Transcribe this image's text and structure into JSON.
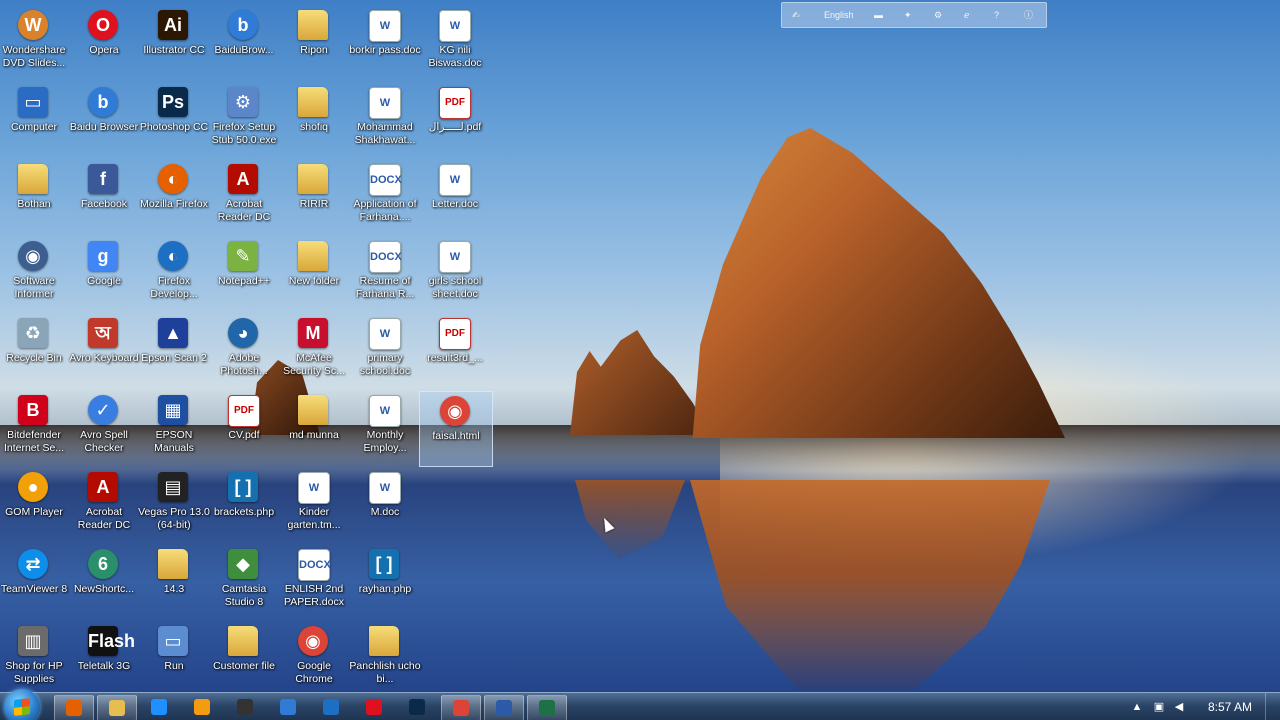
{
  "language_bar": {
    "language": "English"
  },
  "desktop_icons": [
    {
      "label": "Wondershare DVD Slides...",
      "glyph": "W",
      "color": "#d9822b",
      "kind": "round"
    },
    {
      "label": "Opera",
      "glyph": "O",
      "color": "#e0111f",
      "kind": "round"
    },
    {
      "label": "Illustrator CC",
      "glyph": "Ai",
      "color": "#2b1702",
      "kind": "app"
    },
    {
      "label": "BaiduBrow...",
      "glyph": "b",
      "color": "#2f7bd6",
      "kind": "round"
    },
    {
      "label": "Ripon",
      "glyph": "",
      "color": "#e6bd50",
      "kind": "folder"
    },
    {
      "label": "borkir pass.doc",
      "glyph": "W",
      "color": "#2b5aa8",
      "kind": "doc"
    },
    {
      "label": "KG nili Biswas.doc",
      "glyph": "W",
      "color": "#2b5aa8",
      "kind": "doc"
    },
    {
      "label": "Computer",
      "glyph": "▭",
      "color": "#2a6bc4",
      "kind": "app"
    },
    {
      "label": "Baidu Browser",
      "glyph": "b",
      "color": "#2f7bd6",
      "kind": "round"
    },
    {
      "label": "Photoshop CC",
      "glyph": "Ps",
      "color": "#0a2a4a",
      "kind": "app"
    },
    {
      "label": "Firefox Setup Stub 50.0.exe",
      "glyph": "⚙",
      "color": "#5b86c9",
      "kind": "app"
    },
    {
      "label": "shofiq",
      "glyph": "",
      "color": "#e6bd50",
      "kind": "folder"
    },
    {
      "label": "Mohammad Shakhawat...",
      "glyph": "W",
      "color": "#2b5aa8",
      "kind": "doc"
    },
    {
      "label": "لـــــرال.pdf",
      "glyph": "PDF",
      "color": "#c00000",
      "kind": "pdf"
    },
    {
      "label": "Bothan",
      "glyph": "",
      "color": "#e6bd50",
      "kind": "folder"
    },
    {
      "label": "Facebook",
      "glyph": "f",
      "color": "#3b5998",
      "kind": "app"
    },
    {
      "label": "Mozilla Firefox",
      "glyph": "◐",
      "color": "#e66000",
      "kind": "round"
    },
    {
      "label": "Acrobat Reader DC",
      "glyph": "A",
      "color": "#b30b00",
      "kind": "app"
    },
    {
      "label": "RIRIR",
      "glyph": "",
      "color": "#e6bd50",
      "kind": "folder"
    },
    {
      "label": "Application of Farhana....",
      "glyph": "DOCX",
      "color": "#2b5aa8",
      "kind": "doc"
    },
    {
      "label": "Letter.doc",
      "glyph": "W",
      "color": "#2b5aa8",
      "kind": "doc"
    },
    {
      "label": "Software Informer",
      "glyph": "◉",
      "color": "#3d5f8f",
      "kind": "round"
    },
    {
      "label": "Google",
      "glyph": "g",
      "color": "#4285f4",
      "kind": "app"
    },
    {
      "label": "Firefox Develop...",
      "glyph": "◐",
      "color": "#1c6fc2",
      "kind": "round"
    },
    {
      "label": "Notepad++",
      "glyph": "✎",
      "color": "#7bb241",
      "kind": "app"
    },
    {
      "label": "New folder",
      "glyph": "",
      "color": "#e6bd50",
      "kind": "folder"
    },
    {
      "label": "Resume of Farhana R...",
      "glyph": "DOCX",
      "color": "#2b5aa8",
      "kind": "doc"
    },
    {
      "label": "girls school sheet.doc",
      "glyph": "W",
      "color": "#2b5aa8",
      "kind": "doc"
    },
    {
      "label": "Recycle Bin",
      "glyph": "♻",
      "color": "#8aa4b8",
      "kind": "app"
    },
    {
      "label": "Avro Keyboard",
      "glyph": "অ",
      "color": "#c0392b",
      "kind": "app"
    },
    {
      "label": "Epson Scan 2",
      "glyph": "▲",
      "color": "#1e3f9a",
      "kind": "app"
    },
    {
      "label": "Adobe Photosh...",
      "glyph": "◕",
      "color": "#2266aa",
      "kind": "round"
    },
    {
      "label": "McAfee Security Sc...",
      "glyph": "M",
      "color": "#c8102e",
      "kind": "app"
    },
    {
      "label": "primary school.doc",
      "glyph": "W",
      "color": "#2b5aa8",
      "kind": "doc"
    },
    {
      "label": "result3rd_...",
      "glyph": "PDF",
      "color": "#c00000",
      "kind": "pdf"
    },
    {
      "label": "Bitdefender Internet Se...",
      "glyph": "B",
      "color": "#d0021b",
      "kind": "app"
    },
    {
      "label": "Avro Spell Checker",
      "glyph": "✓",
      "color": "#3a7de0",
      "kind": "round"
    },
    {
      "label": "EPSON Manuals",
      "glyph": "▦",
      "color": "#1e4fa0",
      "kind": "app"
    },
    {
      "label": "CV.pdf",
      "glyph": "PDF",
      "color": "#c00000",
      "kind": "pdf"
    },
    {
      "label": "md munna",
      "glyph": "",
      "color": "#e6bd50",
      "kind": "folder"
    },
    {
      "label": "Monthly Employ...",
      "glyph": "W",
      "color": "#2b5aa8",
      "kind": "doc"
    },
    {
      "label": "faisal.html",
      "glyph": "◉",
      "color": "#db4437",
      "kind": "round"
    },
    {
      "label": "GOM Player",
      "glyph": "●",
      "color": "#f2a007",
      "kind": "round"
    },
    {
      "label": "Acrobat Reader DC",
      "glyph": "A",
      "color": "#b30b00",
      "kind": "app"
    },
    {
      "label": "Vegas Pro 13.0 (64-bit)",
      "glyph": "▤",
      "color": "#222222",
      "kind": "app"
    },
    {
      "label": "brackets.php",
      "glyph": "[ ]",
      "color": "#1470af",
      "kind": "app"
    },
    {
      "label": "Kinder garten.tm...",
      "glyph": "W",
      "color": "#2b5aa8",
      "kind": "doc"
    },
    {
      "label": "M.doc",
      "glyph": "W",
      "color": "#2b5aa8",
      "kind": "doc"
    },
    {
      "label": "TeamViewer 8",
      "glyph": "⇄",
      "color": "#0e8ee9",
      "kind": "round"
    },
    {
      "label": "NewShortc...",
      "glyph": "6",
      "color": "#2a8f6b",
      "kind": "round"
    },
    {
      "label": "14.3",
      "glyph": "",
      "color": "#e6bd50",
      "kind": "folder"
    },
    {
      "label": "Camtasia Studio 8",
      "glyph": "◆",
      "color": "#3e8e3e",
      "kind": "app"
    },
    {
      "label": "ENLISH 2nd PAPER.docx",
      "glyph": "DOCX",
      "color": "#2b5aa8",
      "kind": "doc"
    },
    {
      "label": "rayhan.php",
      "glyph": "[ ]",
      "color": "#1470af",
      "kind": "app"
    },
    {
      "label": "Shop for HP Supplies",
      "glyph": "▥",
      "color": "#6b6b6b",
      "kind": "app"
    },
    {
      "label": "Teletalk 3G",
      "glyph": "Flash",
      "color": "#111111",
      "kind": "app"
    },
    {
      "label": "Run",
      "glyph": "▭",
      "color": "#5b8dd0",
      "kind": "app"
    },
    {
      "label": "Customer file",
      "glyph": "",
      "color": "#e6bd50",
      "kind": "folder"
    },
    {
      "label": "Google Chrome",
      "glyph": "◉",
      "color": "#db4437",
      "kind": "round"
    },
    {
      "label": "Panchlish ucho bi...",
      "glyph": "",
      "color": "#e6bd50",
      "kind": "folder"
    }
  ],
  "taskbar": {
    "pinned": [
      {
        "name": "firefox",
        "color": "#e66000",
        "active": true
      },
      {
        "name": "explorer",
        "color": "#e6bd50",
        "active": true
      },
      {
        "name": "ie",
        "color": "#1e90ff",
        "active": false
      },
      {
        "name": "media",
        "color": "#f39c12",
        "active": false
      },
      {
        "name": "vegas",
        "color": "#333333",
        "active": false
      },
      {
        "name": "baidu",
        "color": "#2f7bd6",
        "active": false
      },
      {
        "name": "firefox-dev",
        "color": "#1c6fc2",
        "active": false
      },
      {
        "name": "opera",
        "color": "#e0111f",
        "active": false
      },
      {
        "name": "photoshop",
        "color": "#0a2a4a",
        "active": false
      },
      {
        "name": "chrome",
        "color": "#db4437",
        "active": true
      },
      {
        "name": "word",
        "color": "#2b5aa8",
        "active": true
      },
      {
        "name": "excel",
        "color": "#1e7145",
        "active": true
      }
    ],
    "clock": "8:57 AM"
  }
}
